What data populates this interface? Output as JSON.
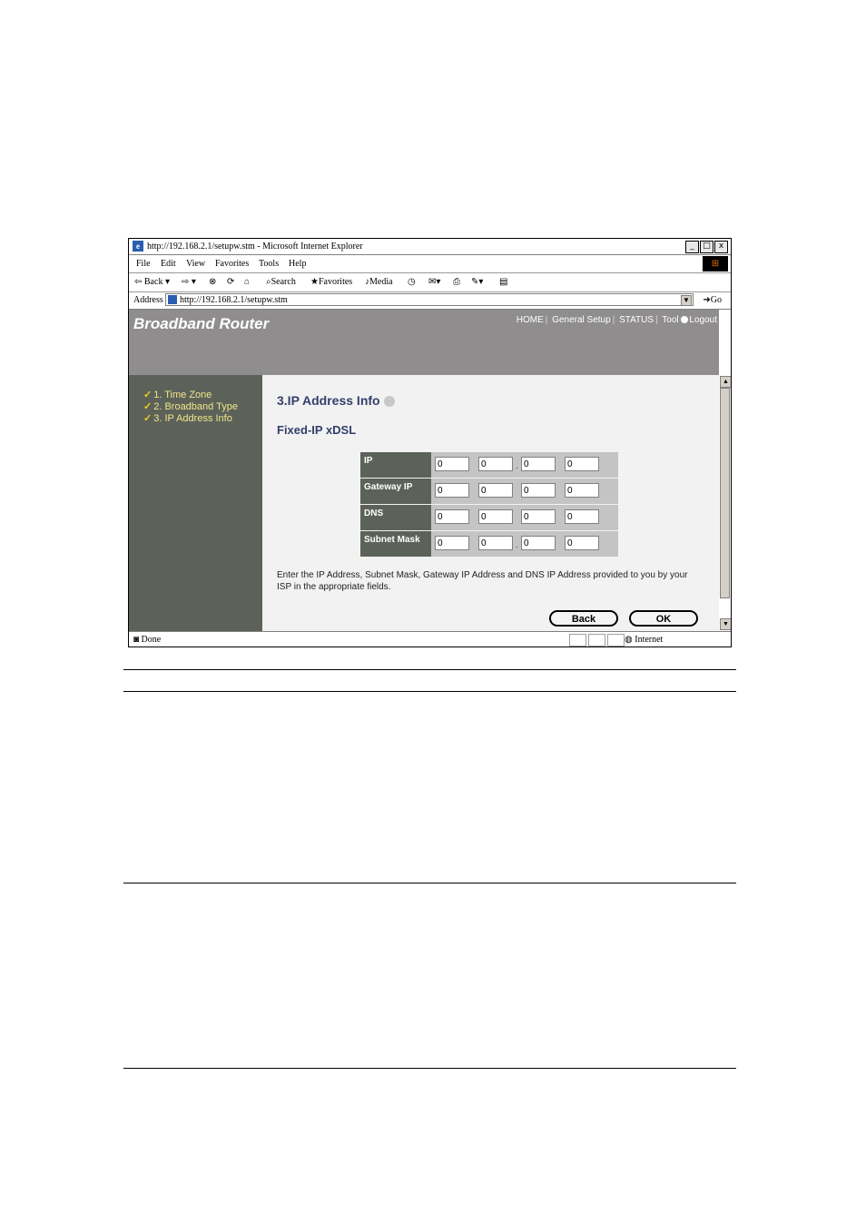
{
  "browser": {
    "title": "http://192.168.2.1/setupw.stm - Microsoft Internet Explorer",
    "window_buttons": [
      "_",
      "□",
      "x"
    ],
    "menu": [
      "File",
      "Edit",
      "View",
      "Favorites",
      "Tools",
      "Help"
    ],
    "toolbar": {
      "back": "Back",
      "search": "Search",
      "favorites": "Favorites",
      "media": "Media"
    },
    "address_label": "Address",
    "address_value": "http://192.168.2.1/setupw.stm",
    "go_label": "Go",
    "status_text": "Done",
    "zone_text": "Internet"
  },
  "router": {
    "brand": "Broadband Router",
    "nav": [
      "HOME",
      "General Setup",
      "STATUS",
      "Tool",
      "Logout"
    ],
    "steps": [
      "1. Time Zone",
      "2. Broadband Type",
      "3. IP Address Info"
    ],
    "page_title": "3.IP Address Info",
    "section_title": "Fixed-IP xDSL",
    "rows": [
      {
        "label": "IP",
        "values": [
          "0",
          "0",
          "0",
          "0"
        ]
      },
      {
        "label": "Gateway IP",
        "values": [
          "0",
          "0",
          "0",
          "0"
        ]
      },
      {
        "label": "DNS",
        "values": [
          "0",
          "0",
          "0",
          "0"
        ]
      },
      {
        "label": "Subnet Mask",
        "values": [
          "0",
          "0",
          "0",
          "0"
        ]
      }
    ],
    "info_text": "Enter the IP Address, Subnet Mask, Gateway IP Address and DNS IP Address provided to you by your ISP in the appropriate fields.",
    "back_button": "Back",
    "ok_button": "OK"
  },
  "colors": {
    "banner": "#8f8d8e",
    "left_panel": "#5c6259",
    "main_panel": "#f2f2f2",
    "title_text": "#333f6b",
    "step_text": "#f0e68a"
  }
}
